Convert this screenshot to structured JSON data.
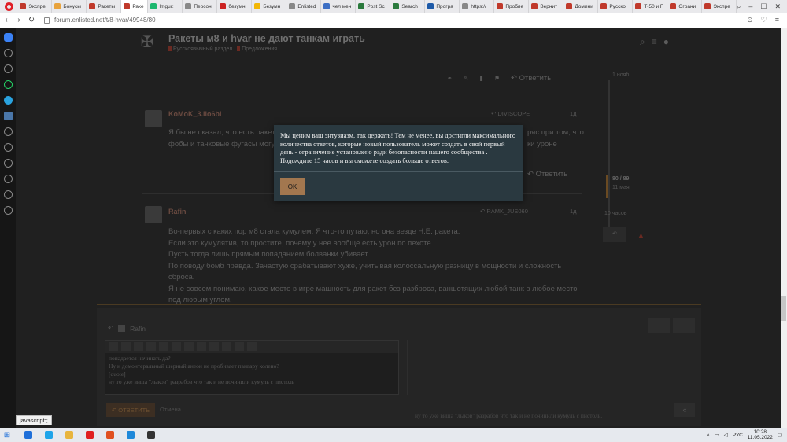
{
  "browser": {
    "tabs": [
      {
        "label": "Экспре",
        "color": "#c0392b",
        "active": false
      },
      {
        "label": "Бонусы",
        "color": "#e8a33d",
        "active": false
      },
      {
        "label": "Ракеты",
        "color": "#c0392b",
        "active": false
      },
      {
        "label": "Раке",
        "color": "#c0392b",
        "active": true
      },
      {
        "label": "Imgur:",
        "color": "#1bb76e",
        "active": false
      },
      {
        "label": "Персон",
        "color": "#888888",
        "active": false
      },
      {
        "label": "безумн",
        "color": "#cc2222",
        "active": false
      },
      {
        "label": "Безумн",
        "color": "#f2b705",
        "active": false
      },
      {
        "label": "Enlisted",
        "color": "#888888",
        "active": false
      },
      {
        "label": "чел мен",
        "color": "#3d6fc4",
        "active": false
      },
      {
        "label": "Post Sc",
        "color": "#2b7a3d",
        "active": false
      },
      {
        "label": "Search",
        "color": "#2b7a3d",
        "active": false
      },
      {
        "label": "Програ",
        "color": "#1e5aa8",
        "active": false
      },
      {
        "label": "https://",
        "color": "#888888",
        "active": false
      },
      {
        "label": "Пробле",
        "color": "#c0392b",
        "active": false
      },
      {
        "label": "Вернит",
        "color": "#c0392b",
        "active": false
      },
      {
        "label": "Домини",
        "color": "#c0392b",
        "active": false
      },
      {
        "label": "Русско",
        "color": "#c0392b",
        "active": false
      },
      {
        "label": "Т-50 и Г",
        "color": "#c0392b",
        "active": false
      },
      {
        "label": "Ограни",
        "color": "#c0392b",
        "active": false
      },
      {
        "label": "Экспре",
        "color": "#c0392b",
        "active": false
      }
    ],
    "url": "forum.enlisted.net/t/8-hvar/49948/80",
    "status_text": "javascript:;"
  },
  "forum": {
    "topic_title": "Ракеты м8 и hvar не дают танкам играть",
    "categories": [
      "Русскоязычный раздел",
      "Предложения"
    ],
    "reply_label": "Ответить",
    "posts": [
      {
        "author": "KoMoK_3.llo6bl",
        "reply_to": "DIVISCOPE",
        "time": "1д",
        "lines": [
          "Я бы не сказал, что есть ракетные",
          "фобы и танковые фугасы могут"
        ],
        "line_tails": [
          "ряс при том, что",
          "ки уроне"
        ]
      },
      {
        "author": "Rafin",
        "reply_to": "RAMK_JUS060",
        "time": "1д",
        "lines": [
          "Во-первых с каких пор м8 стала кумулем. Я что-то путаю, но она везде Н.Е. ракета.",
          "Если это кумулятив, то простите, почему у нее вообще есть урон по пехоте",
          "Пусть тогда лишь прямым попаданием болванки убивает.",
          "По поводу бомб правда. Зачастую срабатывают хуже, учитывая колоссальную разницу в мощности и сложность",
          "сброса.",
          "Я не совсем понимаю, какое место в игре машность для ракет без разброса, ваншотящих любой танк в любое место",
          "под любым углом."
        ]
      }
    ],
    "timeline": {
      "top_date": "1 нояб.",
      "position": "80 / 89",
      "position_sub": "11 мая",
      "bottom_label": "10 часов"
    },
    "composer": {
      "header_label": "Rafin",
      "editor_lines": [
        "попадается начинать да?",
        "Ну и домонтеральный шерный анеон не пробивает пангару колено?",
        "[quote]",
        "ну то уже виша \"лыков\" разрабов что так и не починили кумуль с пистоль"
      ],
      "preview_line": "ну то уже виша \"лыков\" разрабов что так и не починили кумуль с пистоль.",
      "reply_button": "ОТВЕТИТЬ",
      "cancel_button": "Отмена"
    }
  },
  "modal": {
    "message": "Мы ценим ваш энтузиазм, так держать! Тем не менее, вы достигли максимального количества ответов, которые новый пользователь может создать в свой первый день - ограничение установлено ради безопасности нашего сообщества . Подождите 15 часов и вы сможете создать больше ответов.",
    "ok_label": "OK"
  },
  "taskbar": {
    "language": "РУС",
    "time": "10:28",
    "date": "11.05.2022",
    "apps": [
      "#1e6fd9",
      "#1ea4e9",
      "#e8b53d",
      "#e02020",
      "#e05020",
      "#1e88d9",
      "#333333"
    ]
  }
}
